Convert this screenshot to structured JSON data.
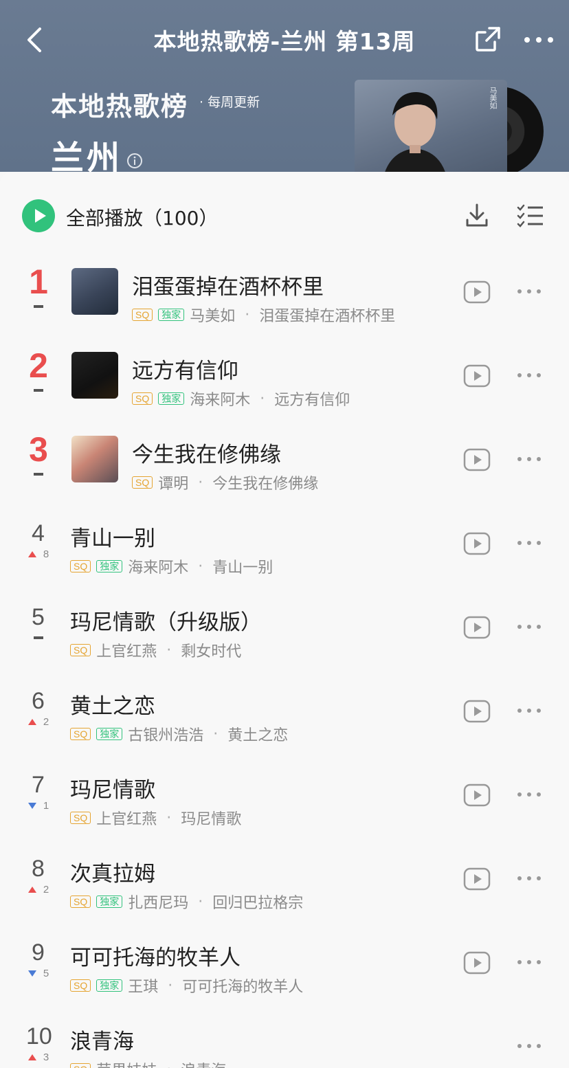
{
  "nav": {
    "title": "本地热歌榜-兰州 第13周"
  },
  "banner": {
    "title": "本地热歌榜",
    "subtitle": "· 每周更新",
    "city": "兰州",
    "cover_text": "马美如"
  },
  "play_all": {
    "label": "全部播放（100）"
  },
  "songs": [
    {
      "rank": "1",
      "change": "",
      "trend": "same",
      "title": "泪蛋蛋掉在酒杯杯里",
      "sq": "SQ",
      "exclusive": "独家",
      "artist": "马美如",
      "album": "泪蛋蛋掉在酒杯杯里"
    },
    {
      "rank": "2",
      "change": "",
      "trend": "same",
      "title": "远方有信仰",
      "sq": "SQ",
      "exclusive": "独家",
      "artist": "海来阿木",
      "album": "远方有信仰"
    },
    {
      "rank": "3",
      "change": "",
      "trend": "same",
      "title": "今生我在修佛缘",
      "sq": "SQ",
      "exclusive": "",
      "artist": "谭明",
      "album": "今生我在修佛缘"
    },
    {
      "rank": "4",
      "change": "8",
      "trend": "up",
      "title": "青山一别",
      "sq": "SQ",
      "exclusive": "独家",
      "artist": "海来阿木",
      "album": "青山一别"
    },
    {
      "rank": "5",
      "change": "",
      "trend": "same",
      "title": "玛尼情歌（升级版）",
      "sq": "SQ",
      "exclusive": "",
      "artist": "上官红燕",
      "album": "剩女时代"
    },
    {
      "rank": "6",
      "change": "2",
      "trend": "up",
      "title": "黄土之恋",
      "sq": "SQ",
      "exclusive": "独家",
      "artist": "古银州浩浩",
      "album": "黄土之恋"
    },
    {
      "rank": "7",
      "change": "1",
      "trend": "down",
      "title": "玛尼情歌",
      "sq": "SQ",
      "exclusive": "",
      "artist": "上官红燕",
      "album": "玛尼情歌"
    },
    {
      "rank": "8",
      "change": "2",
      "trend": "up",
      "title": "次真拉姆",
      "sq": "SQ",
      "exclusive": "独家",
      "artist": "扎西尼玛",
      "album": "回归巴拉格宗"
    },
    {
      "rank": "9",
      "change": "5",
      "trend": "down",
      "title": "可可托海的牧羊人",
      "sq": "SQ",
      "exclusive": "独家",
      "artist": "王琪",
      "album": "可可托海的牧羊人"
    },
    {
      "rank": "10",
      "change": "3",
      "trend": "up",
      "title": "浪青海",
      "sq": "SQ",
      "exclusive": "",
      "artist": "苹果妹妹",
      "album": "浪青海"
    }
  ],
  "colors": {
    "header_bg": "#60728a",
    "accent_green": "#31c27c",
    "rank_red": "#e94e4e",
    "sq_gold": "#e5a431",
    "down_blue": "#4a7bd5"
  }
}
